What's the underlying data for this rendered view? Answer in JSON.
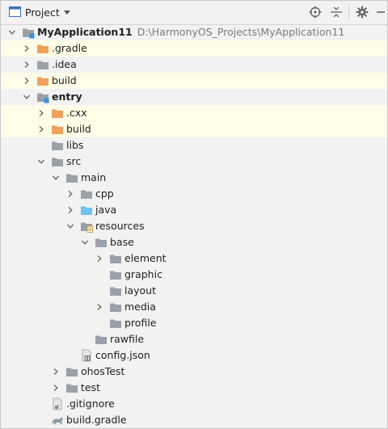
{
  "toolbar": {
    "title": "Project",
    "icons": [
      "project-view-icon",
      "dropdown-arrow-icon",
      "locate-icon",
      "collapse-all-icon",
      "gear-icon",
      "hide-icon"
    ]
  },
  "colors": {
    "folder_gray": "#9aa1a8",
    "folder_orange": "#f0a15c",
    "folder_blue": "#6ec3ef",
    "module_blue": "#3d8fd6",
    "highlight": "#fefde7"
  },
  "tree": [
    {
      "name": "project-root",
      "label": "MyApplication11",
      "path": "D:\\HarmonyOS_Projects\\MyApplication11",
      "depth": 0,
      "chevron": "down",
      "icon": "module",
      "bold": true,
      "highlight": false
    },
    {
      "name": "tree-item-gradle",
      "label": ".gradle",
      "depth": 1,
      "chevron": "right",
      "icon": "folder_orange",
      "highlight": true
    },
    {
      "name": "tree-item-idea",
      "label": ".idea",
      "depth": 1,
      "chevron": "right",
      "icon": "folder_gray",
      "highlight": false
    },
    {
      "name": "tree-item-build-root",
      "label": "build",
      "depth": 1,
      "chevron": "right",
      "icon": "folder_orange",
      "highlight": true
    },
    {
      "name": "tree-item-entry",
      "label": "entry",
      "depth": 1,
      "chevron": "down",
      "icon": "module",
      "bold": true,
      "highlight": false
    },
    {
      "name": "tree-item-cxx",
      "label": ".cxx",
      "depth": 2,
      "chevron": "right",
      "icon": "folder_orange",
      "highlight": true
    },
    {
      "name": "tree-item-build-entry",
      "label": "build",
      "depth": 2,
      "chevron": "right",
      "icon": "folder_orange",
      "highlight": true
    },
    {
      "name": "tree-item-libs",
      "label": "libs",
      "depth": 2,
      "chevron": "none",
      "icon": "folder_gray",
      "highlight": false
    },
    {
      "name": "tree-item-src",
      "label": "src",
      "depth": 2,
      "chevron": "down",
      "icon": "folder_gray",
      "highlight": false
    },
    {
      "name": "tree-item-main",
      "label": "main",
      "depth": 3,
      "chevron": "down",
      "icon": "folder_gray",
      "highlight": false
    },
    {
      "name": "tree-item-cpp",
      "label": "cpp",
      "depth": 4,
      "chevron": "right",
      "icon": "folder_gray",
      "highlight": false
    },
    {
      "name": "tree-item-java",
      "label": "java",
      "depth": 4,
      "chevron": "right",
      "icon": "folder_blue",
      "highlight": false
    },
    {
      "name": "tree-item-resources",
      "label": "resources",
      "depth": 4,
      "chevron": "down",
      "icon": "folder_resources",
      "highlight": false
    },
    {
      "name": "tree-item-base",
      "label": "base",
      "depth": 5,
      "chevron": "down",
      "icon": "folder_gray",
      "highlight": false
    },
    {
      "name": "tree-item-element",
      "label": "element",
      "depth": 6,
      "chevron": "right",
      "icon": "folder_gray",
      "highlight": false
    },
    {
      "name": "tree-item-graphic",
      "label": "graphic",
      "depth": 6,
      "chevron": "none",
      "icon": "folder_gray",
      "highlight": false
    },
    {
      "name": "tree-item-layout",
      "label": "layout",
      "depth": 6,
      "chevron": "none",
      "icon": "folder_gray",
      "highlight": false
    },
    {
      "name": "tree-item-media",
      "label": "media",
      "depth": 6,
      "chevron": "right",
      "icon": "folder_gray",
      "highlight": false
    },
    {
      "name": "tree-item-profile",
      "label": "profile",
      "depth": 6,
      "chevron": "none",
      "icon": "folder_gray",
      "highlight": false
    },
    {
      "name": "tree-item-rawfile",
      "label": "rawfile",
      "depth": 5,
      "chevron": "none",
      "icon": "folder_gray",
      "highlight": false
    },
    {
      "name": "tree-item-config-json",
      "label": "config.json",
      "depth": 4,
      "chevron": "none",
      "icon": "file_config",
      "highlight": false
    },
    {
      "name": "tree-item-ohostest",
      "label": "ohosTest",
      "depth": 3,
      "chevron": "right",
      "icon": "folder_gray",
      "highlight": false
    },
    {
      "name": "tree-item-test",
      "label": "test",
      "depth": 3,
      "chevron": "right",
      "icon": "folder_gray",
      "highlight": false
    },
    {
      "name": "tree-item-gitignore",
      "label": ".gitignore",
      "depth": 2,
      "chevron": "none",
      "icon": "file_gitignore",
      "highlight": false
    },
    {
      "name": "tree-item-build-gradle",
      "label": "build.gradle",
      "depth": 2,
      "chevron": "none",
      "icon": "file_gradle",
      "highlight": false
    }
  ]
}
